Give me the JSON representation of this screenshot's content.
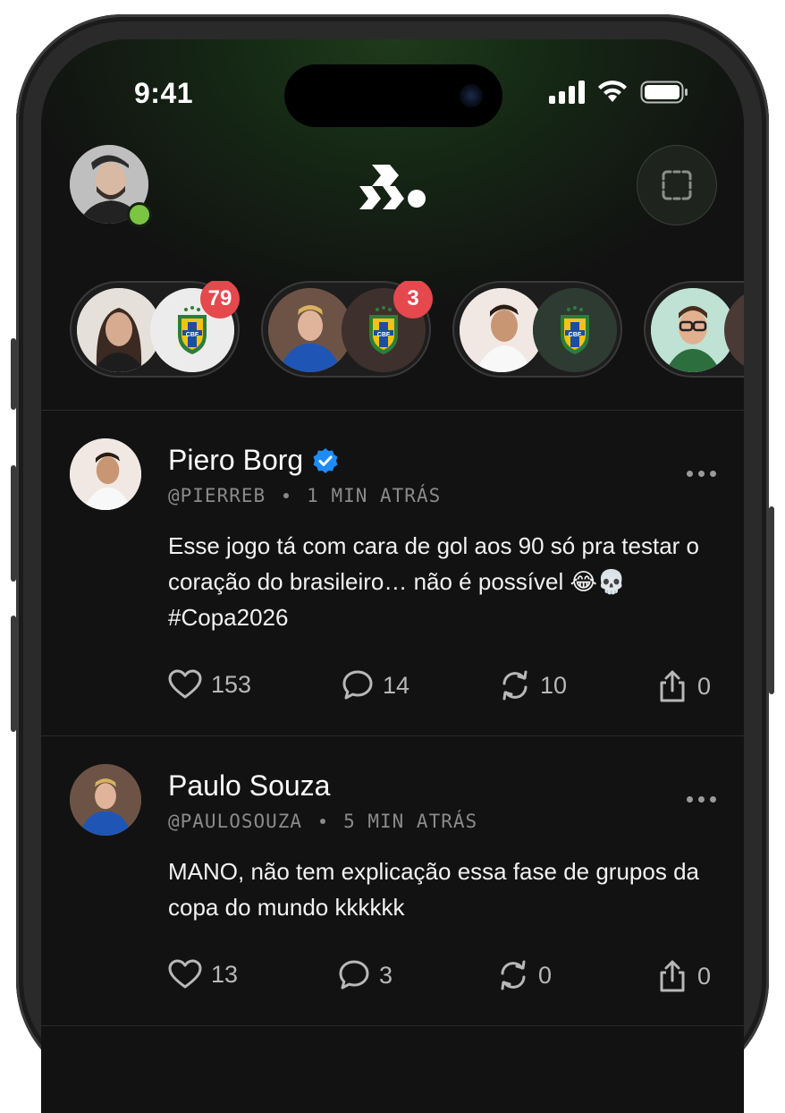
{
  "status_bar": {
    "time": "9:41"
  },
  "header": {
    "avatar_icon": "user-avatar",
    "logo_icon": "app-logo",
    "scan_icon": "scan-frame-icon"
  },
  "stories": [
    {
      "badge": "79",
      "has_badge": true
    },
    {
      "badge": "3",
      "has_badge": true
    },
    {
      "badge": "",
      "has_badge": false
    },
    {
      "badge": "",
      "has_badge": false
    }
  ],
  "crest_label": "CBF",
  "posts": [
    {
      "name": "Piero Borg",
      "verified": true,
      "handle": "@PIERREB",
      "time": "1 MIN ATRÁS",
      "text": "Esse jogo tá com cara de gol aos 90 só pra testar o coração do brasileiro… não é possível 😂💀 #Copa2026",
      "likes": "153",
      "comments": "14",
      "reposts": "10",
      "shares": "0"
    },
    {
      "name": "Paulo Souza",
      "verified": false,
      "handle": "@PAULOSOUZA",
      "time": "5 MIN ATRÁS",
      "text": "MANO, não tem explicação essa fase de grupos da copa do mundo kkkkkk",
      "likes": "13",
      "comments": "3",
      "reposts": "0",
      "shares": "0"
    }
  ],
  "colors": {
    "accent_green": "#7bc542",
    "badge_red": "#e5484d",
    "verified_blue": "#1d8cf8"
  }
}
